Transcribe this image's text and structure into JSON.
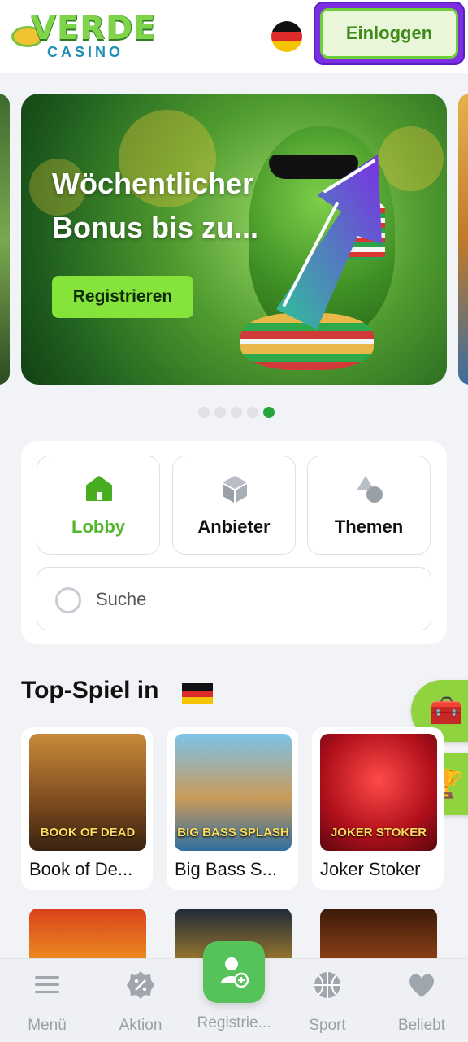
{
  "header": {
    "logo_top": "VERDE",
    "logo_bottom": "CASINO",
    "login_label": "Einloggen"
  },
  "banner": {
    "title": "Wöchentlicher Bonus bis zu...",
    "cta_label": "Registrieren",
    "slides_total": 5,
    "active_slide": 5
  },
  "nav_tabs": [
    {
      "label": "Lobby",
      "icon": "home-icon",
      "active": true
    },
    {
      "label": "Anbieter",
      "icon": "cube-icon",
      "active": false
    },
    {
      "label": "Themen",
      "icon": "shapes-icon",
      "active": false
    }
  ],
  "search": {
    "placeholder": "Suche"
  },
  "top_games": {
    "title": "Top-Spiel in",
    "flag": "germany-flag",
    "games": [
      {
        "name": "Book of De...",
        "thumb_text": "BOOK OF DEAD"
      },
      {
        "name": "Big Bass S...",
        "thumb_text": "BIG BASS SPLASH"
      },
      {
        "name": "Joker Stoker",
        "thumb_text": "JOKER STOKER"
      }
    ]
  },
  "float_buttons": [
    "treasure-chest-icon",
    "trophy-icon"
  ],
  "bottom_nav": [
    {
      "label": "Menü",
      "icon": "menu-icon"
    },
    {
      "label": "Aktion",
      "icon": "percent-badge-icon"
    },
    {
      "label": "Registrie...",
      "icon": "add-user-icon"
    },
    {
      "label": "Sport",
      "icon": "basketball-icon"
    },
    {
      "label": "Beliebt",
      "icon": "heart-icon"
    }
  ],
  "colors": {
    "accent_green": "#86e33a",
    "login_border": "#7b2fe0",
    "active_dot": "#25a43a"
  }
}
